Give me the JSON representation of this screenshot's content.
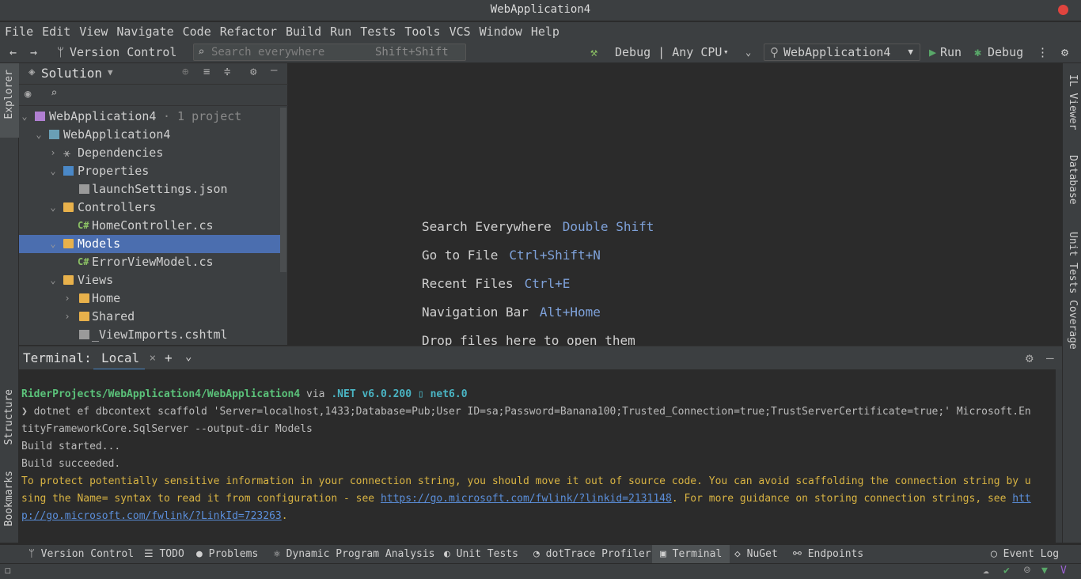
{
  "window": {
    "title": "WebApplication4"
  },
  "menu": [
    "File",
    "Edit",
    "View",
    "Navigate",
    "Code",
    "Refactor",
    "Build",
    "Run",
    "Tests",
    "Tools",
    "VCS",
    "Window",
    "Help"
  ],
  "toolbar": {
    "version_control": "Version Control",
    "search_placeholder": "Search everywhere",
    "search_shortcut": "Shift+Shift",
    "build_config": "Debug | Any CPU",
    "run_config": "WebApplication4",
    "run_label": "Run",
    "debug_label": "Debug"
  },
  "left_strip": {
    "explorer": "Explorer",
    "structure": "Structure",
    "bookmarks": "Bookmarks"
  },
  "right_strip": {
    "il_viewer": "IL Viewer",
    "database": "Database",
    "unit_tests_coverage": "Unit Tests Coverage"
  },
  "solution": {
    "title": "Solution",
    "tree": [
      {
        "label": "WebApplication4",
        "suffix": "· 1 project",
        "kind": "solution"
      },
      {
        "label": "WebApplication4",
        "kind": "project"
      },
      {
        "label": "Dependencies",
        "kind": "deps"
      },
      {
        "label": "Properties",
        "kind": "props"
      },
      {
        "label": "launchSettings.json",
        "kind": "json"
      },
      {
        "label": "Controllers",
        "kind": "folder"
      },
      {
        "label": "HomeController.cs",
        "kind": "cs"
      },
      {
        "label": "Models",
        "kind": "folder",
        "selected": true
      },
      {
        "label": "ErrorViewModel.cs",
        "kind": "cs"
      },
      {
        "label": "Views",
        "kind": "folder"
      },
      {
        "label": "Home",
        "kind": "folder"
      },
      {
        "label": "Shared",
        "kind": "folder"
      },
      {
        "label": "_ViewImports.cshtml",
        "kind": "cshtml"
      }
    ]
  },
  "editor_hints": [
    {
      "label": "Search Everywhere",
      "key": "Double Shift"
    },
    {
      "label": "Go to File",
      "key": "Ctrl+Shift+N"
    },
    {
      "label": "Recent Files",
      "key": "Ctrl+E"
    },
    {
      "label": "Navigation Bar",
      "key": "Alt+Home"
    },
    {
      "label": "Drop files here to open them",
      "key": ""
    }
  ],
  "terminal": {
    "title": "Terminal:",
    "tab": "Local",
    "prompt_path": "RiderProjects/WebApplication4/WebApplication4",
    "prompt_via": "via",
    "prompt_net": ".NET v6.0.200",
    "prompt_tfm": "net6.0",
    "lines": [
      "❯ dotnet ef dbcontext scaffold 'Server=localhost,1433;Database=Pub;User ID=sa;Password=Banana100;Trusted_Connection=true;TrustServerCertificate=true;' Microsoft.En",
      "tityFrameworkCore.SqlServer --output-dir Models",
      "Build started...",
      "Build succeeded."
    ],
    "warning_1": "To protect potentially sensitive information in your connection string, you should move it out of source code. You can avoid scaffolding the connection string by u",
    "warning_2a": "sing the Name= syntax to read it from configuration - see ",
    "warning_2_link": "https://go.microsoft.com/fwlink/?linkid=2131148",
    "warning_2b": ". For more guidance on storing connection strings, see ",
    "warning_2_link2": "htt",
    "warning_3_link": "p://go.microsoft.com/fwlink/?LinkId=723263",
    "warning_3b": "."
  },
  "bottom_tabs": [
    {
      "label": "Version Control",
      "icon": "version-control-icon"
    },
    {
      "label": "TODO",
      "icon": "list-icon"
    },
    {
      "label": "Problems",
      "icon": "problems-icon"
    },
    {
      "label": "Dynamic Program Analysis",
      "icon": "analysis-icon"
    },
    {
      "label": "Unit Tests",
      "icon": "unit-tests-icon"
    },
    {
      "label": "dotTrace Profiler",
      "icon": "profiler-icon"
    },
    {
      "label": "Terminal",
      "icon": "terminal-icon",
      "active": true
    },
    {
      "label": "NuGet",
      "icon": "nuget-icon"
    },
    {
      "label": "Endpoints",
      "icon": "endpoints-icon"
    }
  ],
  "event_log": "Event Log"
}
